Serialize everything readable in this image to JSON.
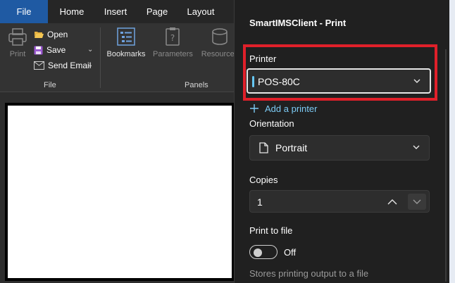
{
  "ribbon": {
    "tabs": [
      {
        "label": "File",
        "active": true
      },
      {
        "label": "Home"
      },
      {
        "label": "Insert"
      },
      {
        "label": "Page"
      },
      {
        "label": "Layout"
      }
    ],
    "file_group": {
      "print_label": "Print",
      "open_label": "Open",
      "save_label": "Save",
      "send_email_label": "Send Email",
      "group_label": "File"
    },
    "panels_group": {
      "bookmarks_label": "Bookmarks",
      "parameters_label": "Parameters",
      "resources_label": "Resources",
      "group_label": "Panels"
    }
  },
  "dialog": {
    "title": "SmartIMSClient - Print",
    "printer_label": "Printer",
    "printer_value": "POS-80C",
    "add_printer_label": "Add a printer",
    "orientation_label": "Orientation",
    "orientation_value": "Portrait",
    "copies_label": "Copies",
    "copies_value": "1",
    "print_to_file_label": "Print to file",
    "print_to_file_state": "Off",
    "print_to_file_hint": "Stores printing output to a file"
  },
  "colors": {
    "accent": "#66c7f4",
    "highlight_box": "#e0202a",
    "file_tab": "#1f5aa3"
  }
}
